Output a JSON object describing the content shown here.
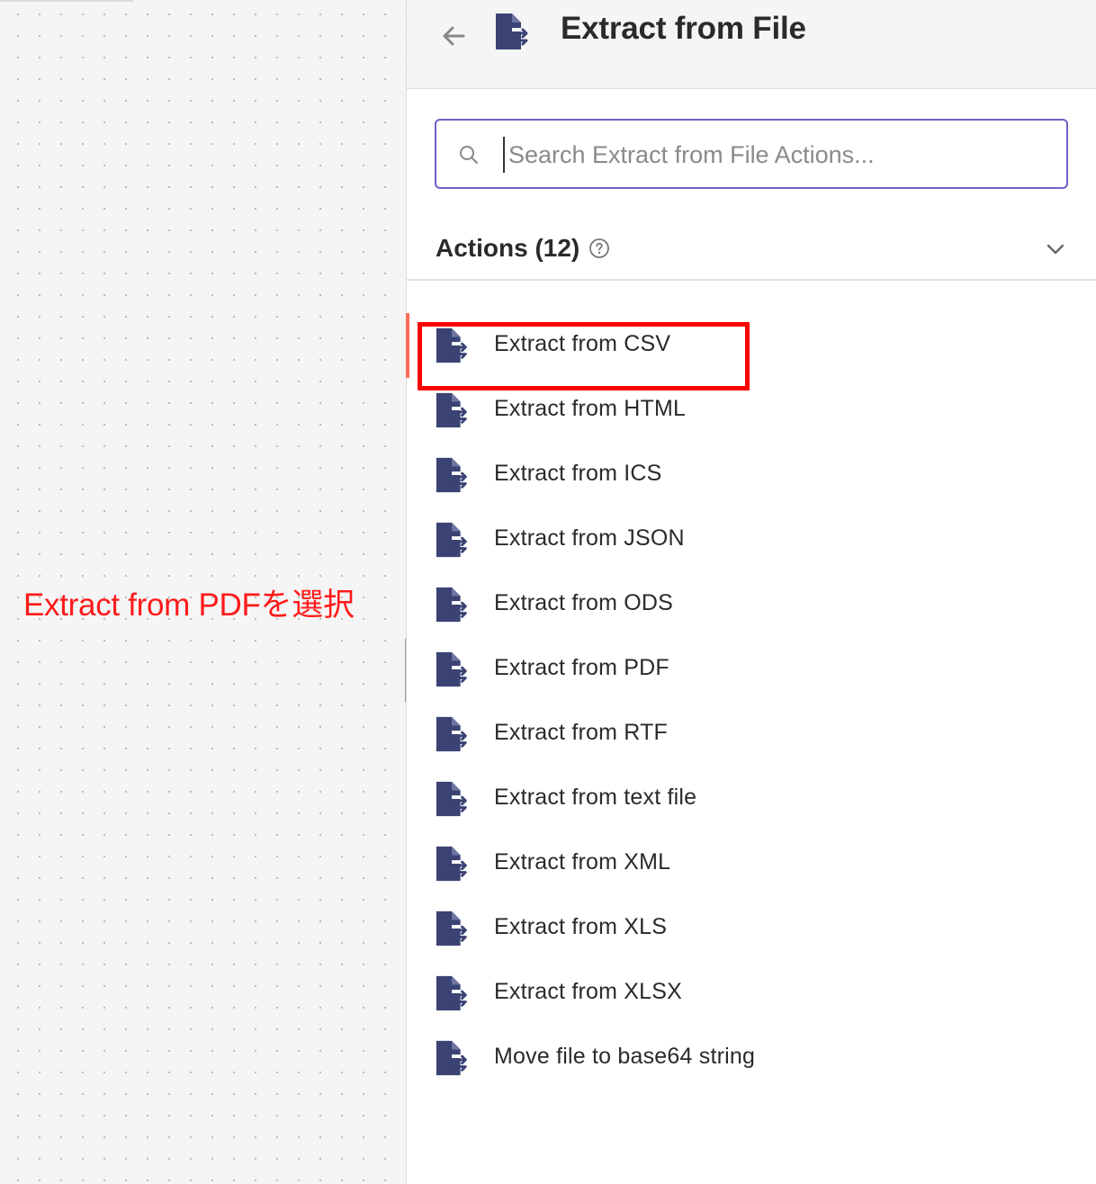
{
  "canvas": {
    "annotation": "Extract from PDFを選択"
  },
  "panel": {
    "title": "Extract from File",
    "back_icon": "arrow-left-icon",
    "node_icon": "file-export-icon",
    "search": {
      "placeholder": "Search Extract from File Actions...",
      "value": "",
      "icon": "search-icon"
    },
    "section": {
      "title": "Actions (12)",
      "help_icon": "question-circle-icon",
      "collapse_icon": "chevron-down-icon"
    },
    "actions": [
      {
        "label": "Extract from CSV"
      },
      {
        "label": "Extract from HTML"
      },
      {
        "label": "Extract from ICS"
      },
      {
        "label": "Extract from JSON"
      },
      {
        "label": "Extract from ODS"
      },
      {
        "label": "Extract from PDF"
      },
      {
        "label": "Extract from RTF"
      },
      {
        "label": "Extract from text file"
      },
      {
        "label": "Extract from XML"
      },
      {
        "label": "Extract from XLS"
      },
      {
        "label": "Extract from XLSX"
      },
      {
        "label": "Move file to base64 string"
      }
    ],
    "active_index": 0,
    "highlighted_index": 5
  },
  "colors": {
    "icon": "#3b4374",
    "accent": "#6b62c9",
    "active_bar": "#ff6d5a",
    "annotation": "#ff1a1a",
    "highlight": "#ff0000"
  }
}
